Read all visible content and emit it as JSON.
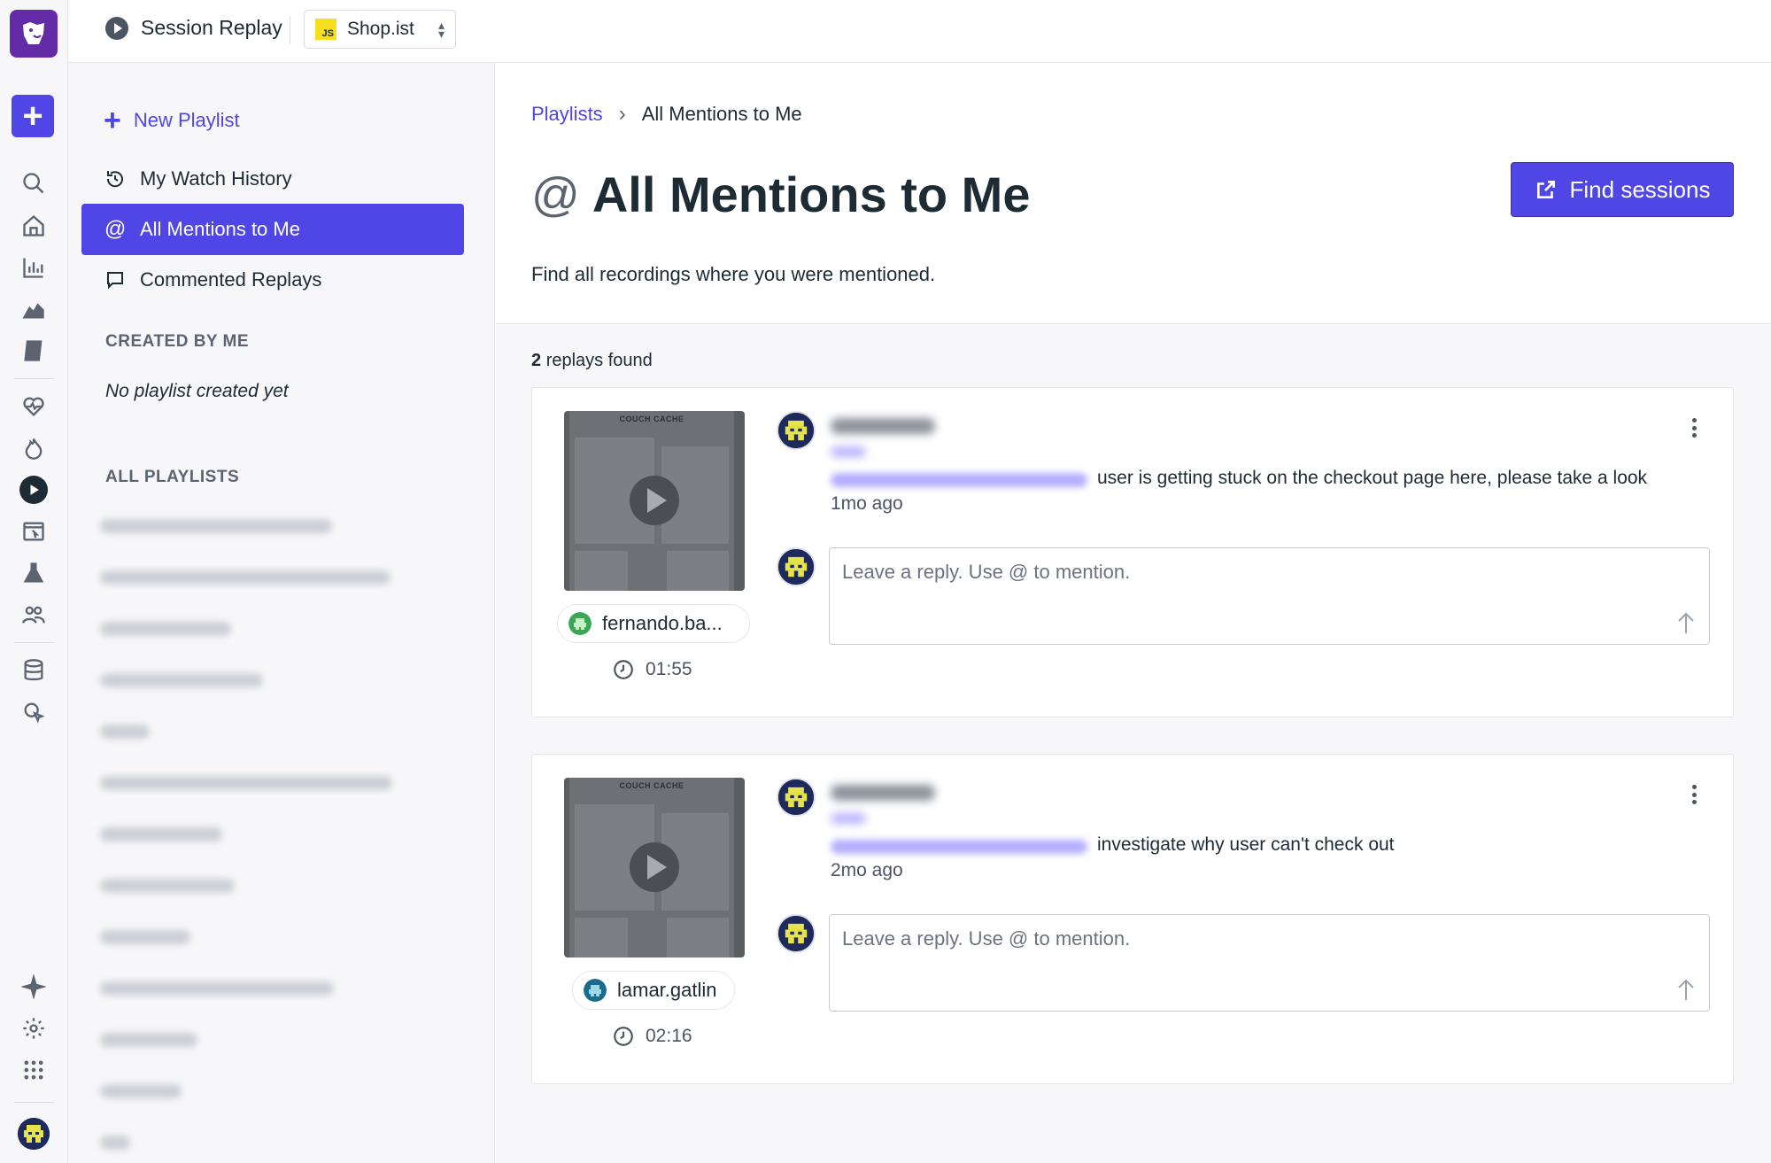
{
  "colors": {
    "accent": "#4f46e5",
    "logo": "#632ca6",
    "text": "#1c2b34"
  },
  "topbar": {
    "product_label": "Session Replay",
    "app_badge": "JS",
    "app_name": "Shop.ist"
  },
  "rail": {
    "icons": [
      "search-icon",
      "home-icon",
      "bar-chart-icon",
      "area-chart-icon",
      "notebook-icon",
      "heartbeat-icon",
      "flame-icon",
      "session-replay-icon",
      "browser-icon",
      "flask-icon",
      "users-icon",
      "database-icon",
      "pointer-icon",
      "sparkle-icon",
      "gear-icon",
      "apps-grid-icon"
    ]
  },
  "sidebar": {
    "new_playlist": "New Playlist",
    "items": [
      {
        "label": "My Watch History",
        "icon": "history-icon"
      },
      {
        "label": "All Mentions to Me",
        "icon": "at-icon"
      },
      {
        "label": "Commented Replays",
        "icon": "comment-icon"
      }
    ],
    "created_heading": "CREATED BY ME",
    "created_empty": "No playlist created yet",
    "all_heading": "ALL PLAYLISTS"
  },
  "main": {
    "breadcrumb": {
      "parent": "Playlists",
      "separator": "›",
      "current": "All Mentions to Me"
    },
    "title_symbol": "@",
    "title": "All Mentions to Me",
    "subtitle": "Find all recordings where you were mentioned.",
    "find_button": "Find sessions",
    "count_number": "2",
    "count_suffix": "replays found",
    "thumb_brand": "COUCH CACHE",
    "reply_placeholder": "Leave a reply. Use @ to mention.",
    "replays": [
      {
        "user": "fernando.ba...",
        "duration": "01:55",
        "comment": "user is getting stuck on the checkout page here, please take a look",
        "time": "1mo ago"
      },
      {
        "user": "lamar.gatlin",
        "duration": "02:16",
        "comment": "investigate why user can't check out",
        "time": "2mo ago"
      }
    ]
  }
}
